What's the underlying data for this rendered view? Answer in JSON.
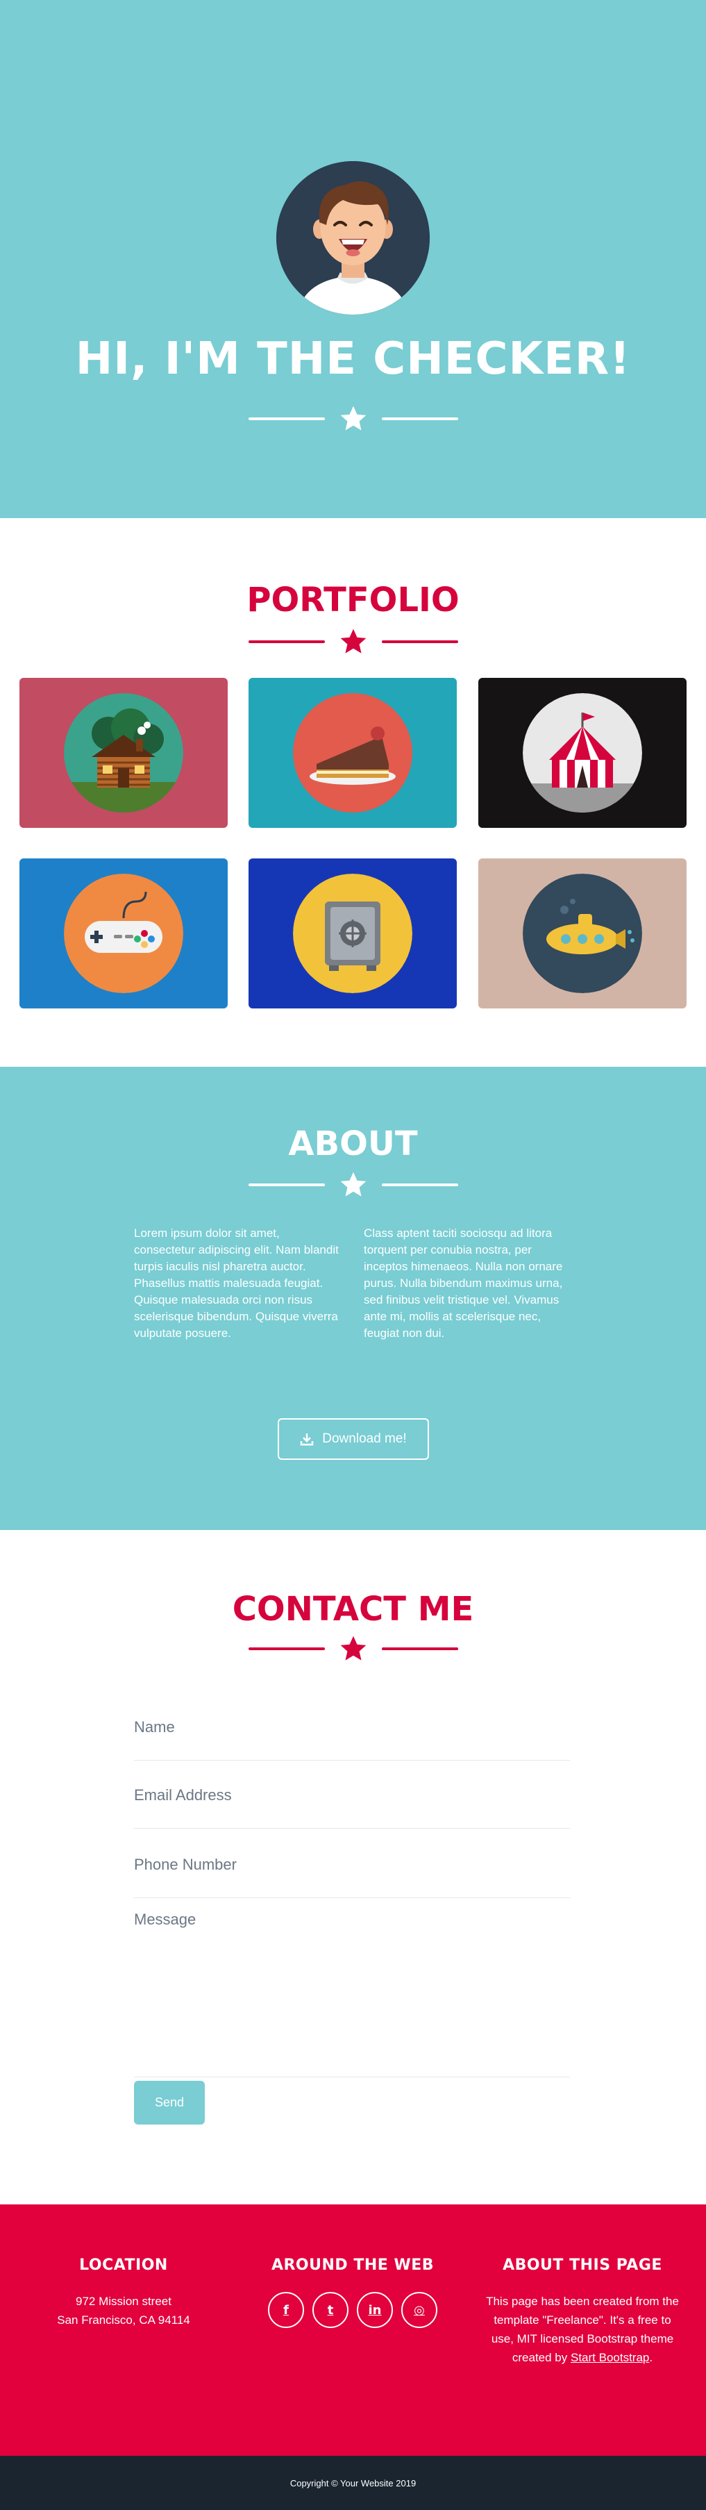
{
  "colors": {
    "teal": "#79cdd3",
    "crimson": "#d6043d",
    "footer_red": "#e2003d",
    "dark": "#1a252f"
  },
  "masthead": {
    "title": "HI, I'M THE CHECKER!",
    "avatar_icon": "smiling-man-avatar-icon",
    "divider_icon": "star-icon"
  },
  "portfolio": {
    "title": "PORTFOLIO",
    "items": [
      {
        "icon": "cabin-icon",
        "bg": "#c24c62"
      },
      {
        "icon": "cake-icon",
        "bg": "#23a6b8"
      },
      {
        "icon": "circus-tent-icon",
        "bg": "#161314"
      },
      {
        "icon": "game-controller-icon",
        "bg": "#1e80c8"
      },
      {
        "icon": "safe-icon",
        "bg": "#1637b5"
      },
      {
        "icon": "submarine-icon",
        "bg": "#d2b4a6"
      }
    ]
  },
  "about": {
    "title": "ABOUT",
    "left_text": "Lorem ipsum dolor sit amet, consectetur adipiscing elit. Nam blandit turpis iaculis nisl pharetra auctor. Phasellus mattis malesuada feugiat. Quisque malesuada orci non risus scelerisque bibendum. Quisque viverra vulputate posuere.",
    "right_text": "Class aptent taciti sociosqu ad litora torquent per conubia nostra, per inceptos himenaeos. Nulla non ornare purus. Nulla bibendum maximus urna, sed finibus velit tristique vel. Vivamus ante mi, mollis at scelerisque nec, feugiat non dui.",
    "button_label": "Download me!",
    "button_icon": "download-icon"
  },
  "contact": {
    "title": "CONTACT ME",
    "name_placeholder": "Name",
    "email_placeholder": "Email Address",
    "phone_placeholder": "Phone Number",
    "message_placeholder": "Message",
    "send_label": "Send"
  },
  "footer": {
    "location_title": "LOCATION",
    "address_line1": "972 Mission street",
    "address_line2": "San Francisco, CA 94114",
    "web_title": "AROUND THE WEB",
    "socials": [
      {
        "icon": "facebook-icon",
        "glyph": "f"
      },
      {
        "icon": "twitter-icon",
        "glyph": "t"
      },
      {
        "icon": "linkedin-icon",
        "glyph": "in"
      },
      {
        "icon": "dribbble-icon",
        "glyph": "◎"
      }
    ],
    "about_title": "ABOUT THIS PAGE",
    "about_text_prefix": "This page has been created from the template \"Freelance\". It's a free to use, MIT licensed Bootstrap theme created by ",
    "about_link": "Start Bootstrap",
    "about_text_suffix": "."
  },
  "copyright": "Copyright © Your Website 2019"
}
